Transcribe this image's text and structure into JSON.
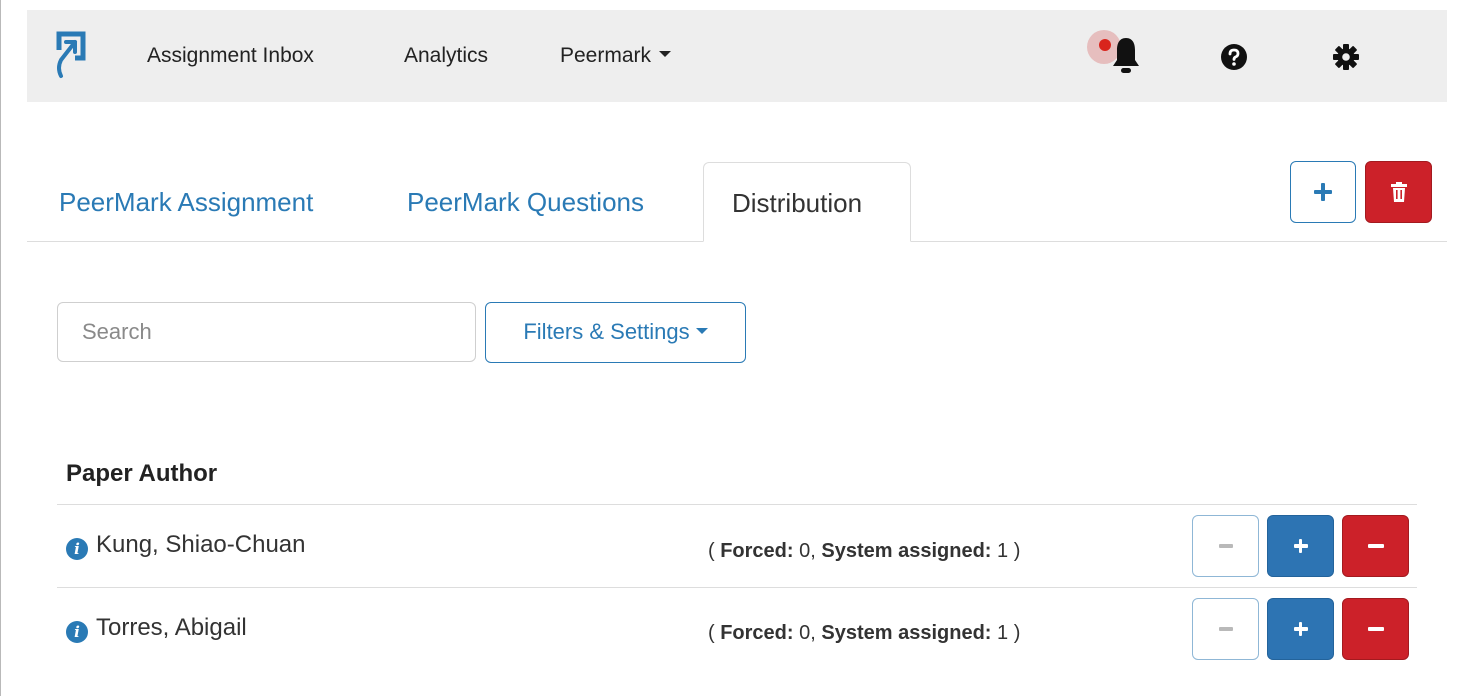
{
  "navbar": {
    "items": [
      {
        "label": "Assignment Inbox"
      },
      {
        "label": "Analytics"
      },
      {
        "label": "Peermark"
      }
    ],
    "icons": [
      "logo-icon",
      "bell-icon",
      "help-icon",
      "gear-icon"
    ]
  },
  "tabs": [
    {
      "label": "PeerMark Assignment",
      "active": false
    },
    {
      "label": "PeerMark Questions",
      "active": false
    },
    {
      "label": "Distribution",
      "active": true
    }
  ],
  "toolbar": {
    "add_icon": "plus-icon",
    "delete_icon": "trash-icon"
  },
  "search": {
    "placeholder": "Search",
    "value": ""
  },
  "filters": {
    "label": "Filters & Settings"
  },
  "table": {
    "header": "Paper Author",
    "rows": [
      {
        "name": "Kung, Shiao-Chuan",
        "forced_label": "Forced:",
        "forced": "0",
        "system_label": "System assigned:",
        "system": "1"
      },
      {
        "name": "Torres, Abigail",
        "forced_label": "Forced:",
        "forced": "0",
        "system_label": "System assigned:",
        "system": "1"
      }
    ]
  },
  "colors": {
    "link": "#2a7ab5",
    "primary": "#2d74b3",
    "danger": "#cc2129",
    "navbar_bg": "#eeeeee"
  }
}
